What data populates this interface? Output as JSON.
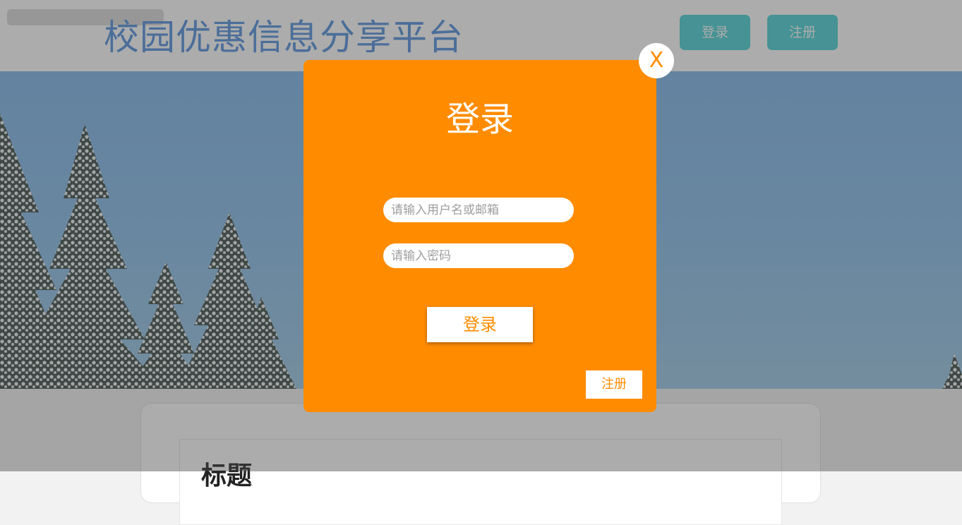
{
  "header": {
    "site_title": "校园优惠信息分享平台",
    "login_label": "登录",
    "register_label": "注册"
  },
  "content": {
    "card_title": "标题"
  },
  "modal": {
    "title": "登录",
    "username_placeholder": "请输入用户名或邮箱",
    "password_placeholder": "请输入密码",
    "login_button": "登录",
    "register_button": "注册",
    "close_label": "X"
  },
  "colors": {
    "modal_bg": "#ff8c00",
    "header_button_bg": "#45cfd4",
    "site_title": "#4f8fdc"
  },
  "icons": {
    "hero_image": "snowy-pine-trees-image"
  }
}
